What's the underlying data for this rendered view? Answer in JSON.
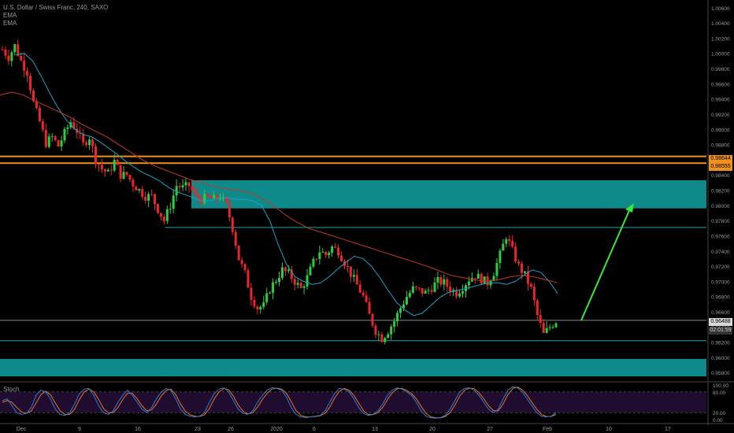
{
  "legend": {
    "symbol_line": "U.S. Dollar / Swiss Franc, 240, SAXO",
    "indicator_1": "EMA",
    "indicator_2": "EMA"
  },
  "stoch_label": "Stoch",
  "badges": {
    "orange_1": "0.98644",
    "orange_2": "0.98555",
    "current_price": "0.96488",
    "countdown": "02:01:59"
  },
  "colors": {
    "background": "#000000",
    "bull": "#2ecc40",
    "bear": "#e8262b",
    "ema_fast": "#1ba1c7",
    "ema_slow": "#c0392b",
    "zone": "#0e8a8a",
    "orange_level": "#f0901e",
    "arrow": "#39e639",
    "stoch_bg": "#1f0c2e",
    "stoch_k": "#2e7cd6",
    "stoch_d": "#e8742a"
  },
  "chart_data": {
    "type": "candlestick",
    "title": "U.S. Dollar / Swiss Franc, 240, SAXO",
    "x_ticks": [
      "Dec",
      "9",
      "16",
      "23",
      "26",
      "2020",
      "6",
      "13",
      "20",
      "27",
      "Feb",
      "10",
      "17"
    ],
    "y_ticks": [
      "1.00600",
      "1.00400",
      "1.00200",
      "1.00000",
      "0.99800",
      "0.99600",
      "0.99400",
      "0.99200",
      "0.99000",
      "0.98800",
      "0.98600",
      "0.98400",
      "0.98200",
      "0.98000",
      "0.97800",
      "0.97600",
      "0.97400",
      "0.97200",
      "0.97000",
      "0.96800",
      "0.96600",
      "0.96400",
      "0.96200",
      "0.96000",
      "0.95800"
    ],
    "ylim": [
      0.9573,
      1.0066
    ],
    "price_path": [
      1.0005,
      0.9995,
      1.001,
      0.999,
      0.9975,
      0.9935,
      0.991,
      0.9882,
      0.989,
      0.9878,
      0.9895,
      0.991,
      0.9898,
      0.988,
      0.989,
      0.986,
      0.9848,
      0.9842,
      0.9858,
      0.984,
      0.984,
      0.9828,
      0.982,
      0.9812,
      0.9812,
      0.9795,
      0.978,
      0.98,
      0.9826,
      0.9823,
      0.9826,
      0.9812,
      0.9808,
      0.981,
      0.9808,
      0.9812,
      0.98,
      0.977,
      0.973,
      0.971,
      0.968,
      0.9665,
      0.9668,
      0.969,
      0.9702,
      0.9715,
      0.971,
      0.97,
      0.969,
      0.9705,
      0.9725,
      0.974,
      0.9735,
      0.9745,
      0.974,
      0.9725,
      0.971,
      0.9695,
      0.968,
      0.9655,
      0.9635,
      0.9625,
      0.9635,
      0.9648,
      0.9665,
      0.968,
      0.969,
      0.9688,
      0.9685,
      0.9692,
      0.97,
      0.9698,
      0.969,
      0.9685,
      0.9693,
      0.9703,
      0.9708,
      0.9703,
      0.9698,
      0.9712,
      0.9735,
      0.976,
      0.974,
      0.972,
      0.9708,
      0.969,
      0.9655,
      0.963,
      0.964,
      0.9648
    ],
    "ema_fast": [
      0.9998,
      1.0,
      0.999,
      0.997,
      0.9948,
      0.9928,
      0.9912,
      0.99,
      0.9893,
      0.989,
      0.9883,
      0.9875,
      0.9867,
      0.9858,
      0.985,
      0.9843,
      0.9838,
      0.9832,
      0.9824,
      0.9818,
      0.9814,
      0.981,
      0.9806,
      0.9806,
      0.981,
      0.981,
      0.9808,
      0.9808,
      0.9806,
      0.98,
      0.978,
      0.9748,
      0.9722,
      0.9706,
      0.97,
      0.9696,
      0.9698,
      0.9706,
      0.9716,
      0.9725,
      0.9733,
      0.973,
      0.972,
      0.9705,
      0.9688,
      0.9672,
      0.9662,
      0.9655,
      0.9658,
      0.9668,
      0.9678,
      0.9685,
      0.9688,
      0.969,
      0.9693,
      0.9696,
      0.9698,
      0.9698,
      0.9696,
      0.97,
      0.9708,
      0.9715,
      0.9712,
      0.97,
      0.9684
    ],
    "ema_slow": [
      0.9945,
      0.9949,
      0.9945,
      0.9937,
      0.993,
      0.9923,
      0.9915,
      0.9906,
      0.9898,
      0.989,
      0.988,
      0.987,
      0.986,
      0.9852,
      0.9846,
      0.984,
      0.9834,
      0.983,
      0.9825,
      0.9822,
      0.982,
      0.9817,
      0.981,
      0.98,
      0.9788,
      0.9778,
      0.977,
      0.9765,
      0.976,
      0.9755,
      0.975,
      0.9745,
      0.974,
      0.9735,
      0.973,
      0.9725,
      0.972,
      0.9714,
      0.9708,
      0.9705,
      0.9702,
      0.97,
      0.9702,
      0.9706,
      0.9708,
      0.9706,
      0.9702,
      0.9698
    ],
    "resistance_lines": [
      0.98644,
      0.98555
    ],
    "zones": [
      [
        0.9796,
        0.9833
      ],
      [
        0.9575,
        0.9598
      ]
    ],
    "support_lines": [
      0.9771,
      0.96488,
      0.9622
    ],
    "stochastic": {
      "ylim": [
        0,
        100
      ],
      "y_ticks": [
        "100.00",
        "80.00",
        "20.00",
        "0.00"
      ],
      "k": [
        55,
        60,
        40,
        20,
        15,
        18,
        35,
        70,
        85,
        80,
        60,
        30,
        15,
        12,
        20,
        45,
        75,
        88,
        90,
        70,
        40,
        20,
        15,
        25,
        50,
        70,
        85,
        70,
        50,
        30,
        20,
        35,
        60,
        80,
        90,
        85,
        60,
        30,
        15,
        10,
        8,
        10,
        20,
        50,
        75,
        88,
        92,
        80,
        55,
        30,
        18,
        15,
        25,
        50,
        70,
        85,
        92,
        90,
        85,
        65,
        35,
        15,
        8,
        6,
        8,
        10,
        12,
        25,
        50,
        75,
        90,
        88,
        80,
        60,
        35,
        18,
        12,
        15,
        25,
        45,
        70,
        85,
        92,
        88,
        80,
        70,
        50,
        25,
        10,
        5,
        4,
        6,
        12,
        30,
        55,
        80,
        90,
        92,
        85,
        70,
        50,
        30,
        20,
        30,
        60,
        85,
        95,
        92,
        80,
        60,
        40,
        20,
        10,
        8,
        10,
        20
      ],
      "d": [
        50,
        55,
        50,
        35,
        22,
        18,
        25,
        48,
        72,
        82,
        72,
        48,
        25,
        15,
        15,
        30,
        58,
        80,
        88,
        80,
        58,
        32,
        20,
        20,
        35,
        58,
        76,
        76,
        60,
        40,
        25,
        28,
        45,
        68,
        84,
        88,
        72,
        45,
        24,
        14,
        10,
        9,
        14,
        32,
        60,
        80,
        90,
        86,
        68,
        42,
        24,
        16,
        20,
        36,
        58,
        76,
        88,
        91,
        88,
        76,
        52,
        26,
        12,
        8,
        8,
        9,
        11,
        18,
        36,
        62,
        82,
        90,
        85,
        70,
        48,
        26,
        15,
        14,
        20,
        35,
        58,
        78,
        89,
        90,
        84,
        75,
        60,
        38,
        18,
        8,
        5,
        5,
        9,
        20,
        42,
        68,
        85,
        91,
        89,
        78,
        60,
        40,
        26,
        25,
        45,
        72,
        90,
        94,
        86,
        70,
        50,
        30,
        15,
        9,
        9,
        15
      ]
    }
  }
}
